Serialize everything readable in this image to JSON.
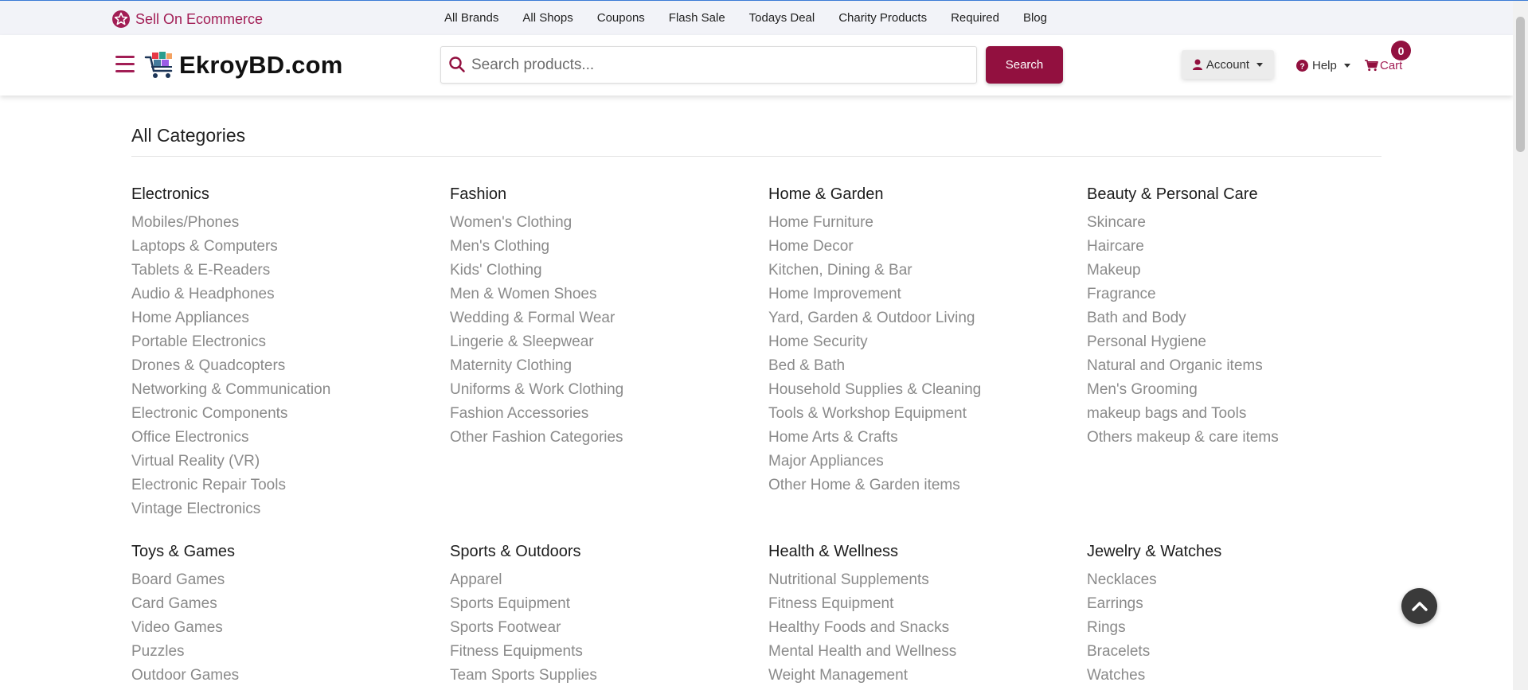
{
  "topbar": {
    "sell_label": "Sell On Ecommerce",
    "nav": [
      "All Brands",
      "All Shops",
      "Coupons",
      "Flash Sale",
      "Todays Deal",
      "Charity Products",
      "Required",
      "Blog"
    ]
  },
  "header": {
    "logo_text": "EkroyBD.com",
    "search_placeholder": "Search products...",
    "search_button": "Search",
    "account_label": "Account",
    "help_label": "Help",
    "cart_label": "Cart",
    "cart_count": "0"
  },
  "colors": {
    "brand": "#92103f",
    "accent": "#a21e55",
    "category_item": "#8a8a8a"
  },
  "icons": {
    "sell": "star-circle-icon",
    "menu": "hamburger-menu-icon",
    "logo": "shopping-cart-logo-icon",
    "search": "search-icon",
    "account": "user-icon",
    "help": "question-circle-icon",
    "cart": "cart-icon",
    "scroll_top": "chevron-up-icon"
  },
  "page": {
    "title": "All Categories"
  },
  "categories": [
    {
      "title": "Electronics",
      "items": [
        "Mobiles/Phones",
        "Laptops & Computers",
        "Tablets & E-Readers",
        "Audio & Headphones",
        "Home Appliances",
        "Portable Electronics",
        "Drones & Quadcopters",
        "Networking & Communication",
        "Electronic Components",
        "Office Electronics",
        "Virtual Reality (VR)",
        "Electronic Repair Tools",
        "Vintage Electronics"
      ]
    },
    {
      "title": "Fashion",
      "items": [
        "Women's Clothing",
        "Men's Clothing",
        "Kids' Clothing",
        "Men & Women Shoes",
        "Wedding & Formal Wear",
        "Lingerie & Sleepwear",
        "Maternity Clothing",
        "Uniforms & Work Clothing",
        "Fashion Accessories",
        "Other Fashion Categories"
      ]
    },
    {
      "title": "Home & Garden",
      "items": [
        "Home Furniture",
        "Home Decor",
        "Kitchen, Dining & Bar",
        "Home Improvement",
        "Yard, Garden & Outdoor Living",
        "Home Security",
        "Bed & Bath",
        "Household Supplies & Cleaning",
        "Tools & Workshop Equipment",
        "Home Arts & Crafts",
        "Major Appliances",
        "Other Home & Garden items"
      ]
    },
    {
      "title": "Beauty & Personal Care",
      "items": [
        "Skincare",
        "Haircare",
        "Makeup",
        "Fragrance",
        "Bath and Body",
        "Personal Hygiene",
        "Natural and Organic items",
        "Men's Grooming",
        "makeup bags and Tools",
        "Others makeup & care items"
      ]
    },
    {
      "title": "Toys & Games",
      "items": [
        "Board Games",
        "Card Games",
        "Video Games",
        "Puzzles",
        "Outdoor Games"
      ]
    },
    {
      "title": "Sports & Outdoors",
      "items": [
        "Apparel",
        "Sports Equipment",
        "Sports Footwear",
        "Fitness Equipments",
        "Team Sports Supplies"
      ]
    },
    {
      "title": "Health & Wellness",
      "items": [
        "Nutritional Supplements",
        "Fitness Equipment",
        "Healthy Foods and Snacks",
        "Mental Health and Wellness",
        "Weight Management"
      ]
    },
    {
      "title": "Jewelry & Watches",
      "items": [
        "Necklaces",
        "Earrings",
        "Rings",
        "Bracelets",
        "Watches"
      ]
    }
  ]
}
